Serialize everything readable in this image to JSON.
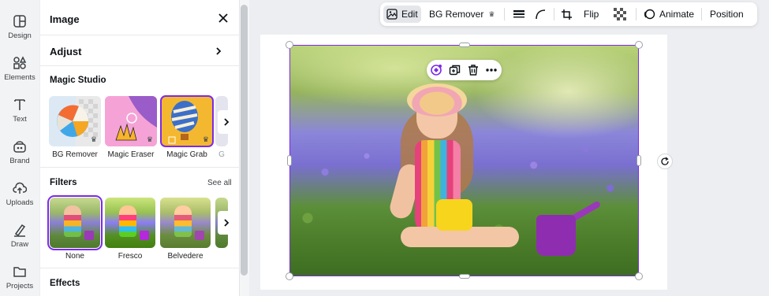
{
  "rail": {
    "items": [
      {
        "label": "Design",
        "icon": "design-icon"
      },
      {
        "label": "Elements",
        "icon": "elements-icon"
      },
      {
        "label": "Text",
        "icon": "text-icon"
      },
      {
        "label": "Brand",
        "icon": "brand-icon"
      },
      {
        "label": "Uploads",
        "icon": "uploads-icon"
      },
      {
        "label": "Draw",
        "icon": "draw-icon"
      },
      {
        "label": "Projects",
        "icon": "projects-icon"
      }
    ]
  },
  "panel": {
    "title": "Image",
    "adjust_label": "Adjust",
    "magic_studio": {
      "heading": "Magic Studio",
      "tools": [
        {
          "label": "BG Remover"
        },
        {
          "label": "Magic Eraser"
        },
        {
          "label": "Magic Grab"
        },
        {
          "label": "G"
        }
      ]
    },
    "filters": {
      "heading": "Filters",
      "see_all": "See all",
      "items": [
        {
          "label": "None",
          "selected": true
        },
        {
          "label": "Fresco",
          "selected": false
        },
        {
          "label": "Belvedere",
          "selected": false
        }
      ]
    },
    "effects_heading": "Effects"
  },
  "toolbar": {
    "edit": "Edit",
    "bg_remover": "BG Remover",
    "flip": "Flip",
    "animate": "Animate",
    "position": "Position"
  },
  "colors": {
    "accent": "#7d2ae8",
    "crown": "#3c4043"
  }
}
